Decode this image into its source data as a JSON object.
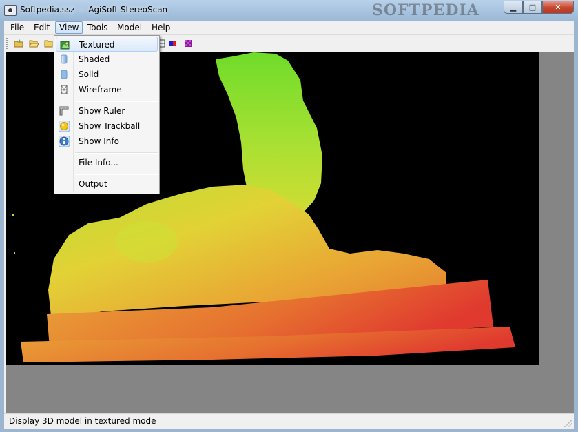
{
  "window": {
    "title": "Softpedia.ssz — AgiSoft StereoScan",
    "watermark": "SOFTPEDIA",
    "controls": {
      "minimize": "▁",
      "maximize": "□",
      "close": "✕"
    }
  },
  "menubar": {
    "items": [
      {
        "label": "File"
      },
      {
        "label": "Edit"
      },
      {
        "label": "View"
      },
      {
        "label": "Tools"
      },
      {
        "label": "Model"
      },
      {
        "label": "Help"
      }
    ],
    "open_menu": "View"
  },
  "toolbar": {
    "buttons": [
      {
        "icon": "new-project-icon"
      },
      {
        "icon": "open-folder-icon"
      },
      {
        "icon": "open-folder-2-icon"
      },
      {
        "icon": "wireframe-toggle-icon"
      },
      {
        "icon": "red-blue-stereo-icon"
      },
      {
        "icon": "purple-checker-icon"
      }
    ]
  },
  "view_menu": {
    "items": [
      {
        "label": "Textured",
        "icon": "textured-mode-icon",
        "highlighted": true
      },
      {
        "label": "Shaded",
        "icon": "shaded-mode-icon"
      },
      {
        "label": "Solid",
        "icon": "solid-mode-icon"
      },
      {
        "label": "Wireframe",
        "icon": "wireframe-mode-icon"
      },
      {
        "label": "Show Ruler",
        "icon": "ruler-icon"
      },
      {
        "label": "Show Trackball",
        "icon": "trackball-icon"
      },
      {
        "label": "Show Info",
        "icon": "info-icon"
      },
      {
        "label": "File Info...",
        "icon": ""
      },
      {
        "label": "Output",
        "icon": ""
      }
    ]
  },
  "status": {
    "text": "Display 3D model in textured mode"
  },
  "colors": {
    "model_low": "#e03a2f",
    "model_mid": "#e6c431",
    "model_high": "#7fdc2c",
    "viewport_bg": "#000000",
    "panel_gray": "#858585"
  }
}
